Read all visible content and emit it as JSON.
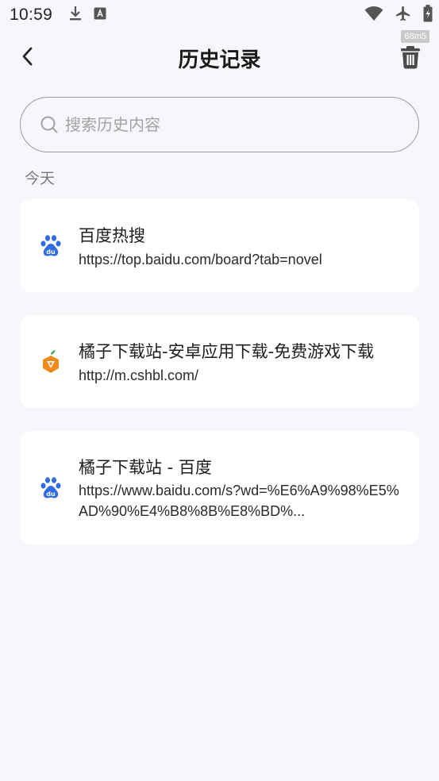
{
  "status": {
    "time": "10:59",
    "badge": "68m5"
  },
  "header": {
    "title": "历史记录"
  },
  "search": {
    "placeholder": "搜索历史内容",
    "value": ""
  },
  "section": {
    "label": "今天"
  },
  "history": [
    {
      "title": "百度热搜",
      "url": "https://top.baidu.com/board?tab=novel",
      "icon": "baidu-icon"
    },
    {
      "title": "橘子下载站-安卓应用下载-免费游戏下载",
      "url": "http://m.cshbl.com/",
      "icon": "orange-site-icon"
    },
    {
      "title": "橘子下载站 - 百度",
      "url": "https://www.baidu.com/s?wd=%E6%A9%98%E5%AD%90%E4%B8%8B%E8%BD%...",
      "icon": "baidu-icon"
    }
  ],
  "colors": {
    "background": "#f6f7fb",
    "card": "#ffffff",
    "baidu_blue": "#2f6be5",
    "orange": "#f08a1c"
  }
}
